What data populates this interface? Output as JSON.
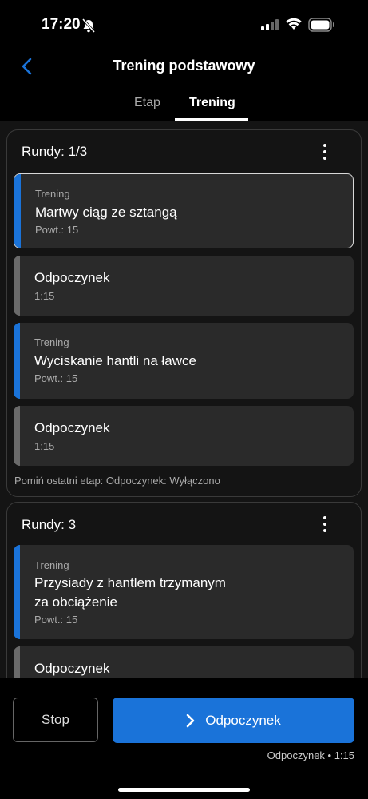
{
  "status_bar": {
    "time": "17:20"
  },
  "nav": {
    "title": "Trening podstawowy"
  },
  "tabs": [
    {
      "label": "Etap"
    },
    {
      "label": "Trening"
    }
  ],
  "blocks": [
    {
      "title": "Rundy: 1/3",
      "steps": [
        {
          "type": "Trening",
          "name": "Martwy ciąg ze sztangą",
          "detail": "Powt.: 15"
        },
        {
          "name": "Odpoczynek",
          "detail": "1:15"
        },
        {
          "type": "Trening",
          "name": "Wyciskanie hantli na ławce",
          "detail": "Powt.: 15"
        },
        {
          "name": "Odpoczynek",
          "detail": "1:15"
        }
      ],
      "note": "Pomiń ostatni etap: Odpoczynek: Wyłączono"
    },
    {
      "title": "Rundy: 3",
      "steps": [
        {
          "type": "Trening",
          "name_line1": "Przysiady z hantlem trzymanym",
          "name_line2": "za obciążenie",
          "detail": "Powt.: 15"
        },
        {
          "name": "Odpoczynek"
        }
      ]
    }
  ],
  "footer": {
    "stop_label": "Stop",
    "next_label": "Odpoczynek",
    "next_info": "Odpoczynek • 1:15"
  },
  "colors": {
    "accent": "#1a73d9",
    "rest_bar": "#6a6a6a",
    "card": "#2a2a2a"
  }
}
